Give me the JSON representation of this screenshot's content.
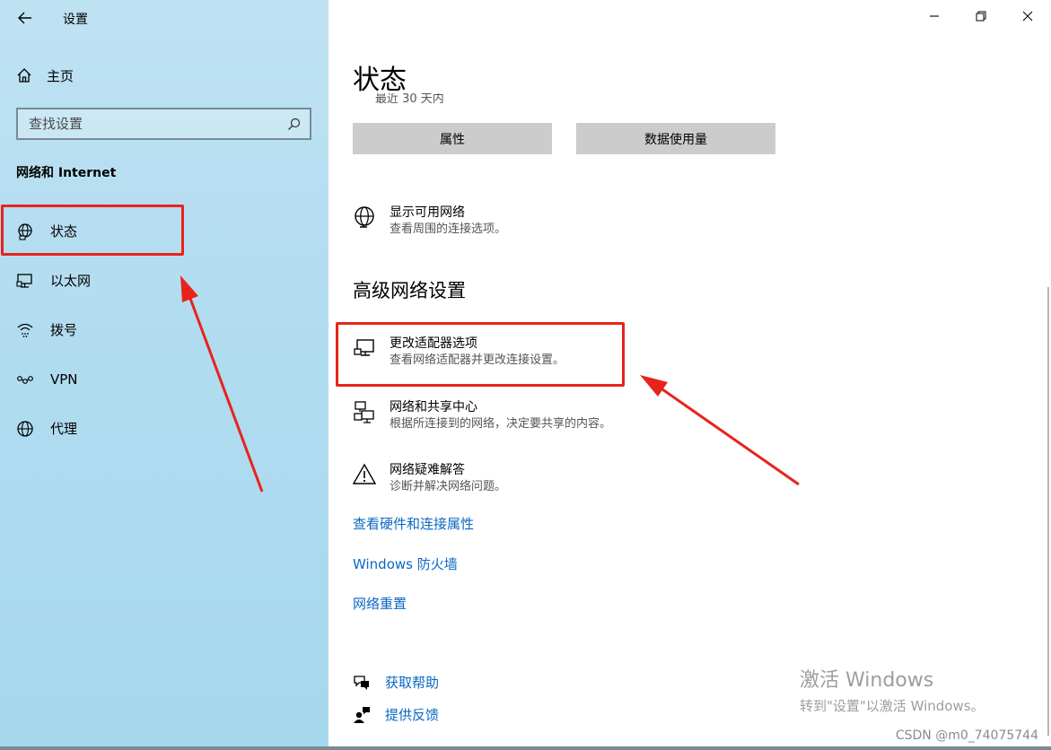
{
  "window": {
    "title": "设置"
  },
  "sidebar": {
    "home_label": "主页",
    "search_placeholder": "查找设置",
    "section_title": "网络和 Internet",
    "items": [
      {
        "label": "状态",
        "icon": "globe-network-icon"
      },
      {
        "label": "以太网",
        "icon": "ethernet-icon"
      },
      {
        "label": "拨号",
        "icon": "dialup-icon"
      },
      {
        "label": "VPN",
        "icon": "vpn-icon"
      },
      {
        "label": "代理",
        "icon": "globe-icon"
      }
    ]
  },
  "main": {
    "page_title": "状态",
    "partial_text": "最近 30 天内",
    "buttons": {
      "properties": "属性",
      "data_usage": "数据使用量"
    },
    "show_networks": {
      "title": "显示可用网络",
      "desc": "查看周围的连接选项。"
    },
    "advanced_title": "高级网络设置",
    "options": [
      {
        "title": "更改适配器选项",
        "desc": "查看网络适配器并更改连接设置。"
      },
      {
        "title": "网络和共享中心",
        "desc": "根据所连接到的网络，决定要共享的内容。"
      },
      {
        "title": "网络疑难解答",
        "desc": "诊断并解决网络问题。"
      }
    ],
    "links": {
      "hardware": "查看硬件和连接属性",
      "firewall": "Windows 防火墙",
      "reset": "网络重置"
    },
    "help": {
      "get_help": "获取帮助",
      "feedback": "提供反馈"
    },
    "activation": {
      "line1": "激活 Windows",
      "line2": "转到\"设置\"以激活 Windows。"
    },
    "watermark": "CSDN @m0_74075744"
  },
  "colors": {
    "highlight": "#e8231b",
    "link": "#0a67c4",
    "button_bg": "#cccccc"
  }
}
